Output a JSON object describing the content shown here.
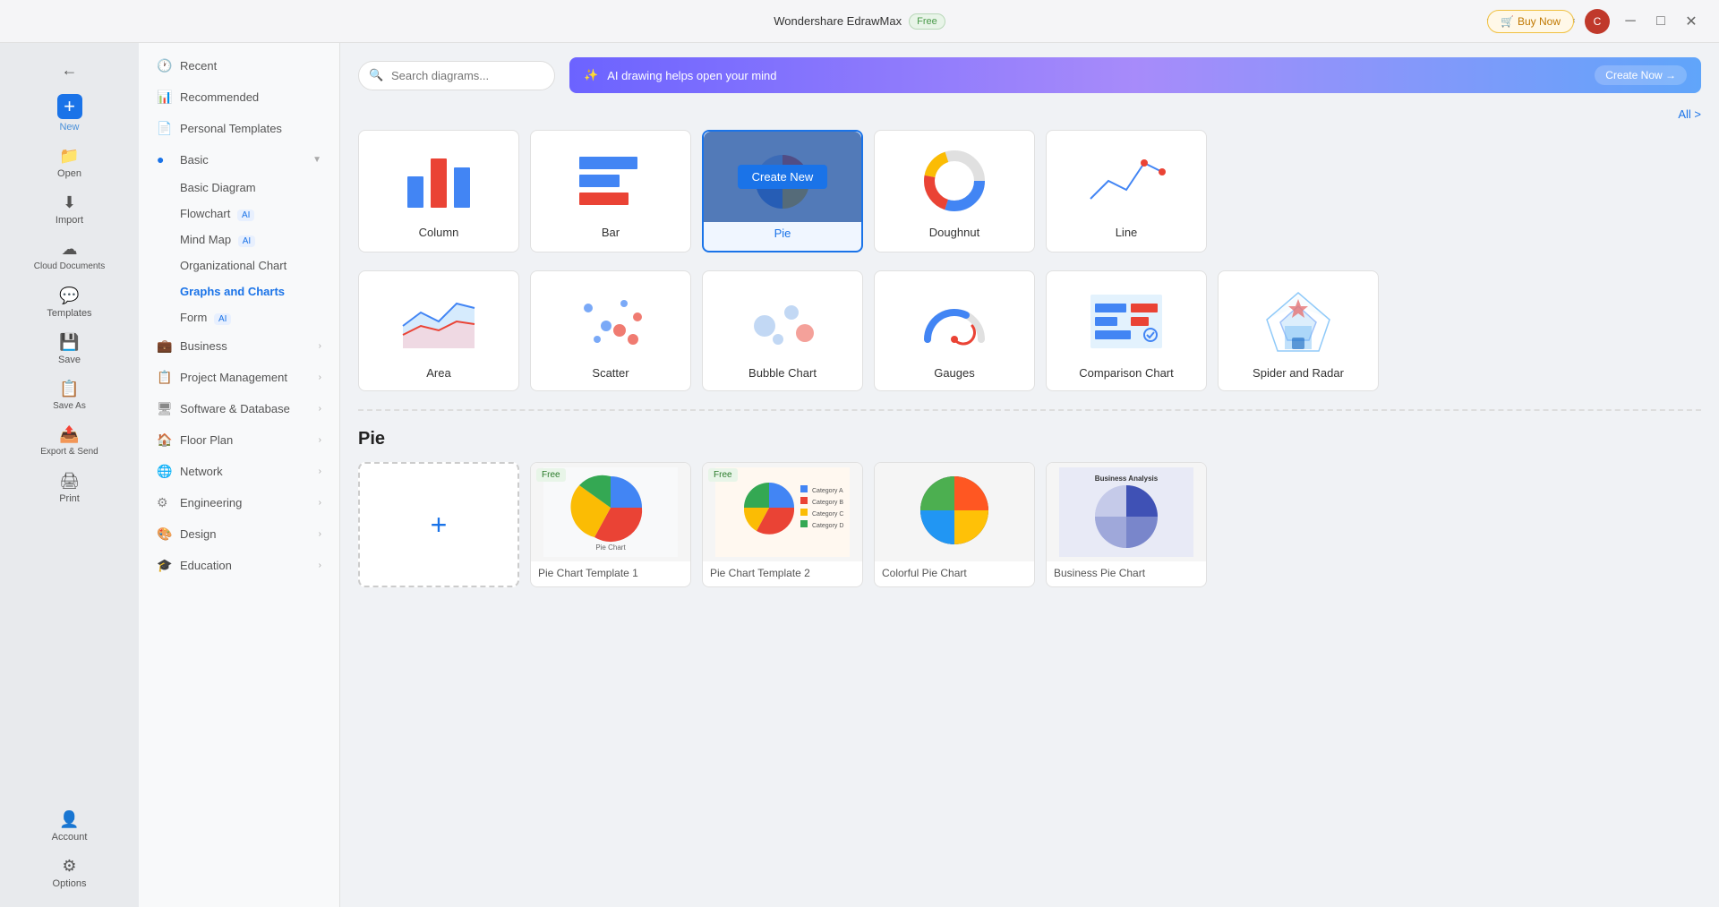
{
  "app": {
    "title": "Wondershare EdrawMax",
    "badge": "Free",
    "buy_now": "Buy Now"
  },
  "titlebar": {
    "minimize": "─",
    "maximize": "□",
    "close": "✕",
    "avatar_letter": "C"
  },
  "left_sidebar": {
    "items": [
      {
        "id": "back",
        "icon": "←",
        "label": ""
      },
      {
        "id": "new",
        "icon": "+",
        "label": "New",
        "active": true
      },
      {
        "id": "open",
        "icon": "📂",
        "label": "Open"
      },
      {
        "id": "import",
        "icon": "⬇",
        "label": "Import"
      },
      {
        "id": "cloud",
        "icon": "☁",
        "label": "Cloud Documents"
      },
      {
        "id": "templates",
        "icon": "💬",
        "label": "Templates"
      },
      {
        "id": "save",
        "icon": "💾",
        "label": "Save"
      },
      {
        "id": "save-as",
        "icon": "📋",
        "label": "Save As"
      },
      {
        "id": "export",
        "icon": "📤",
        "label": "Export & Send"
      },
      {
        "id": "print",
        "icon": "🖨",
        "label": "Print"
      }
    ],
    "bottom_items": [
      {
        "id": "account",
        "icon": "👤",
        "label": "Account"
      },
      {
        "id": "options",
        "icon": "⚙",
        "label": "Options"
      }
    ]
  },
  "nav_sidebar": {
    "items": [
      {
        "id": "recent",
        "icon": "🕐",
        "label": "Recent",
        "active": false
      },
      {
        "id": "recommended",
        "icon": "📊",
        "label": "Recommended",
        "active": false
      },
      {
        "id": "personal-templates",
        "icon": "📄",
        "label": "Personal Templates",
        "active": false
      },
      {
        "id": "basic",
        "icon": "🔵",
        "label": "Basic",
        "expanded": true,
        "active": false
      },
      {
        "id": "basic-diagram",
        "label": "Basic Diagram",
        "sub": true
      },
      {
        "id": "flowchart",
        "label": "Flowchart",
        "sub": true,
        "ai": true
      },
      {
        "id": "mind-map",
        "label": "Mind Map",
        "sub": true,
        "ai": true
      },
      {
        "id": "org-chart",
        "label": "Organizational Chart",
        "sub": true
      },
      {
        "id": "graphs-charts",
        "label": "Graphs and Charts",
        "sub": true,
        "active": true
      },
      {
        "id": "form",
        "label": "Form",
        "sub": true,
        "ai": true
      },
      {
        "id": "business",
        "icon": "💼",
        "label": "Business",
        "chevron": true
      },
      {
        "id": "project-mgmt",
        "icon": "📋",
        "label": "Project Management",
        "chevron": true
      },
      {
        "id": "software-db",
        "icon": "🖥",
        "label": "Software & Database",
        "chevron": true
      },
      {
        "id": "floor-plan",
        "icon": "🏠",
        "label": "Floor Plan",
        "chevron": true
      },
      {
        "id": "network",
        "icon": "🌐",
        "label": "Network",
        "chevron": true
      },
      {
        "id": "engineering",
        "icon": "⚙",
        "label": "Engineering",
        "chevron": true
      },
      {
        "id": "design",
        "icon": "🎨",
        "label": "Design",
        "chevron": true
      },
      {
        "id": "education",
        "icon": "🎓",
        "label": "Education",
        "chevron": true
      }
    ]
  },
  "search": {
    "placeholder": "Search diagrams..."
  },
  "ai_banner": {
    "text": "AI drawing helps open your mind",
    "button": "Create Now →"
  },
  "all_link": "All >",
  "charts": [
    {
      "id": "column",
      "label": "Column"
    },
    {
      "id": "bar",
      "label": "Bar"
    },
    {
      "id": "pie",
      "label": "Pie",
      "selected": true,
      "create_new": true
    },
    {
      "id": "doughnut",
      "label": "Doughnut"
    },
    {
      "id": "line",
      "label": "Line"
    },
    {
      "id": "area",
      "label": "Area"
    },
    {
      "id": "scatter",
      "label": "Scatter"
    },
    {
      "id": "bubble",
      "label": "Bubble Chart"
    },
    {
      "id": "gauges",
      "label": "Gauges"
    },
    {
      "id": "comparison",
      "label": "Comparison Chart"
    },
    {
      "id": "spider",
      "label": "Spider and Radar"
    }
  ],
  "templates_section": {
    "title": "Pie",
    "add_label": "+",
    "templates": [
      {
        "id": "t1",
        "free": true,
        "label": "Pie Chart Template 1"
      },
      {
        "id": "t2",
        "free": true,
        "label": "Pie Chart Template 2"
      },
      {
        "id": "t3",
        "free": false,
        "label": "Colorful Pie Chart"
      },
      {
        "id": "t4",
        "free": false,
        "label": "Business Pie Chart"
      }
    ]
  }
}
